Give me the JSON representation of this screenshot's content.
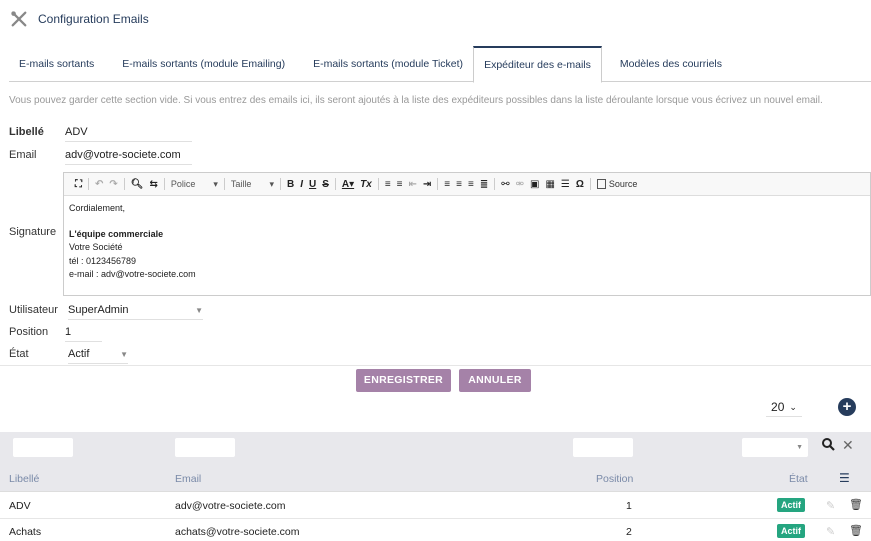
{
  "header": {
    "title": "Configuration Emails",
    "icon": "tools-icon"
  },
  "tabs": [
    {
      "label": "E-mails sortants"
    },
    {
      "label": "E-mails sortants (module Emailing)"
    },
    {
      "label": "E-mails sortants (module Ticket)"
    },
    {
      "label": "Expéditeur des e-mails",
      "active": true
    },
    {
      "label": "Modèles des courriels"
    }
  ],
  "info_text": "Vous pouvez garder cette section vide. Si vous entrez des emails ici, ils seront ajoutés à la liste des expéditeurs possibles dans la liste déroulante lorsque vous écrivez un nouvel email.",
  "form": {
    "label_label": "Libellé",
    "label_value": "ADV",
    "email_label": "Email",
    "email_value": "adv@votre-societe.com",
    "signature_label": "Signature",
    "user_label": "Utilisateur",
    "user_value": "SuperAdmin",
    "position_label": "Position",
    "position_value": "1",
    "state_label": "État",
    "state_value": "Actif"
  },
  "editor": {
    "toolbar": {
      "font": "Police",
      "size": "Taille",
      "source": "Source"
    },
    "lines": [
      "Cordialement,",
      "",
      "L'équipe commerciale",
      "Votre Société",
      "tél : 0123456789",
      "e-mail : adv@votre-societe.com"
    ]
  },
  "buttons": {
    "save": "ENREGISTRER",
    "cancel": "ANNULER"
  },
  "pagination": {
    "page_size": "20"
  },
  "table": {
    "columns": {
      "label": "Libellé",
      "email": "Email",
      "position": "Position",
      "state": "État"
    },
    "rows": [
      {
        "label": "ADV",
        "email": "adv@votre-societe.com",
        "position": "1",
        "state": "Actif"
      },
      {
        "label": "Achats",
        "email": "achats@votre-societe.com",
        "position": "2",
        "state": "Actif"
      }
    ]
  },
  "colors": {
    "primary": "#263c5c",
    "button": "#a582a8",
    "badge": "#25a580"
  }
}
